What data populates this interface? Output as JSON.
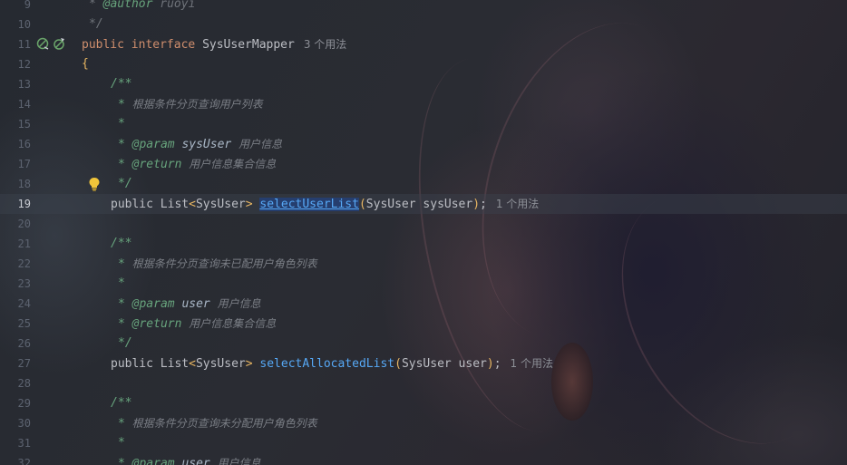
{
  "editor": {
    "usage_hints": {
      "interface": "3 个用法",
      "select_user_list": "1 个用法",
      "select_allocated_list": "1 个用法"
    },
    "lines": [
      {
        "num": "9"
      },
      {
        "num": "10"
      },
      {
        "num": "11"
      },
      {
        "num": "12"
      },
      {
        "num": "13"
      },
      {
        "num": "14"
      },
      {
        "num": "15"
      },
      {
        "num": "16"
      },
      {
        "num": "17"
      },
      {
        "num": "18"
      },
      {
        "num": "19"
      },
      {
        "num": "20"
      },
      {
        "num": "21"
      },
      {
        "num": "22"
      },
      {
        "num": "23"
      },
      {
        "num": "24"
      },
      {
        "num": "25"
      },
      {
        "num": "26"
      },
      {
        "num": "27"
      },
      {
        "num": "28"
      },
      {
        "num": "29"
      },
      {
        "num": "30"
      },
      {
        "num": "31"
      },
      {
        "num": "32"
      }
    ],
    "tokens": {
      "star": "*",
      "author_tag": "@author",
      "author_name": "ruoyi",
      "comment_end": "*/",
      "comment_start": "/**",
      "kw_public": "public",
      "kw_interface": "interface",
      "interface_name": "SysUserMapper",
      "open_brace": "{",
      "doc1": "根据条件分页查询用户列表",
      "param_tag": "@param",
      "return_tag": "@return",
      "param_sysuser": "sysUser",
      "param_user": "user",
      "user_info": "用户信息",
      "user_info_collection": "用户信息集合信息",
      "list_type": "List",
      "lt": "<",
      "gt": ">",
      "sysuser_type": "SysUser",
      "method1": "selectUserList",
      "method1_args": "SysUser sysUser",
      "lparen": "(",
      "rparen": ")",
      "semicolon": ";",
      "doc2": "根据条件分页查询未已配用户角色列表",
      "method2": "selectAllocatedList",
      "method2_args": "SysUser user",
      "doc3": "根据条件分页查询未分配用户角色列表"
    }
  },
  "colors": {
    "keyword": "#cf8e6d",
    "function": "#56a8f5",
    "javadoc_tag": "#67a37c",
    "comment": "#7a7e85",
    "bracket": "#e8b662"
  },
  "icons": {
    "gutter_1": "implemented-mapper-icon",
    "gutter_2": "mybatis-bird-icon",
    "intention": "lightbulb-icon"
  }
}
